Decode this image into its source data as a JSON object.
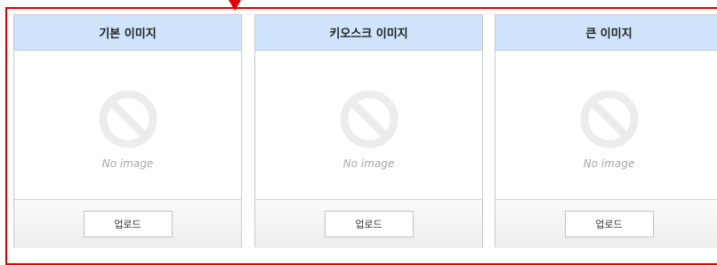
{
  "cards": [
    {
      "title": "기본 이미지",
      "placeholder": "No image",
      "upload_label": "업로드"
    },
    {
      "title": "키오스크 이미지",
      "placeholder": "No image",
      "upload_label": "업로드"
    },
    {
      "title": "큰 이미지",
      "placeholder": "No image",
      "upload_label": "업로드"
    }
  ],
  "icons": {
    "placeholder_icon": "no-image-prohibited-icon",
    "pointer": "arrow-down-icon"
  },
  "colors": {
    "highlight": "#e00000",
    "header_bg": "#cfe4fb",
    "placeholder_gray": "#a8a8a8"
  }
}
